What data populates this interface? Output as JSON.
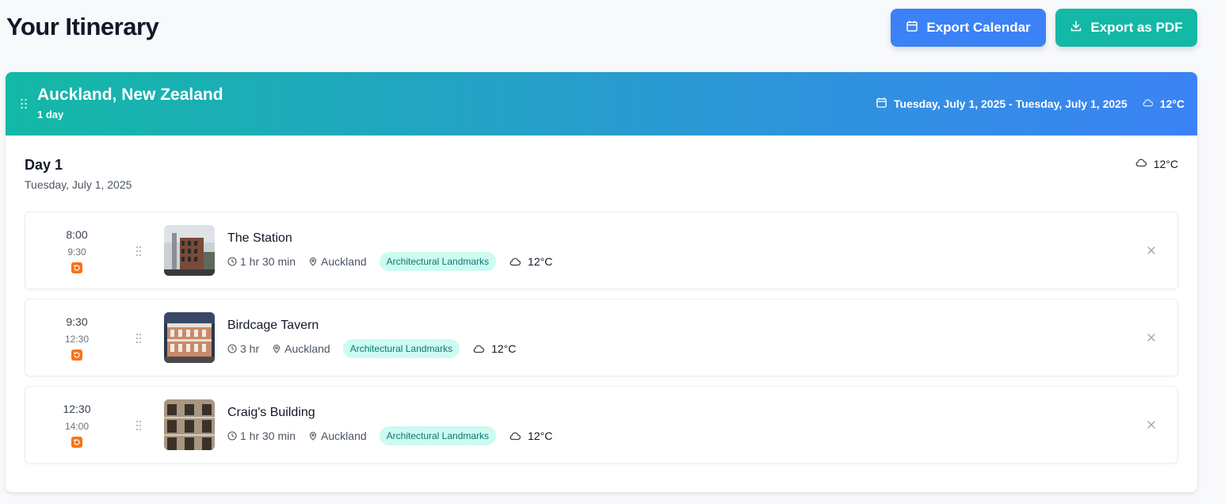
{
  "page": {
    "title": "Your Itinerary"
  },
  "toolbar": {
    "export_calendar_label": "Export Calendar",
    "export_pdf_label": "Export as PDF"
  },
  "colors": {
    "primary_blue": "#3b82f6",
    "teal": "#14b8a6",
    "tag_bg": "#ccfbf1",
    "tag_text": "#0f766e",
    "sync_orange": "#f97316"
  },
  "destination": {
    "name": "Auckland, New Zealand",
    "duration": "1 day",
    "date_range": "Tuesday, July 1, 2025 - Tuesday, July 1, 2025",
    "temperature": "12°C"
  },
  "day": {
    "title": "Day 1",
    "date": "Tuesday, July 1, 2025",
    "temperature": "12°C",
    "activities": [
      {
        "start": "8:00",
        "end": "9:30",
        "name": "The Station",
        "duration": "1 hr 30 min",
        "location": "Auckland",
        "category": "Architectural Landmarks",
        "temperature": "12°C"
      },
      {
        "start": "9:30",
        "end": "12:30",
        "name": "Birdcage Tavern",
        "duration": "3 hr",
        "location": "Auckland",
        "category": "Architectural Landmarks",
        "temperature": "12°C"
      },
      {
        "start": "12:30",
        "end": "14:00",
        "name": "Craig's Building",
        "duration": "1 hr 30 min",
        "location": "Auckland",
        "category": "Architectural Landmarks",
        "temperature": "12°C"
      }
    ]
  },
  "icons": {
    "calendar": "calendar-icon",
    "download": "download-icon",
    "drag": "drag-handle-icon",
    "cloud": "cloud-icon",
    "clock": "clock-icon",
    "map_pin": "map-pin-icon",
    "sync": "sync-icon",
    "close": "close-icon"
  }
}
